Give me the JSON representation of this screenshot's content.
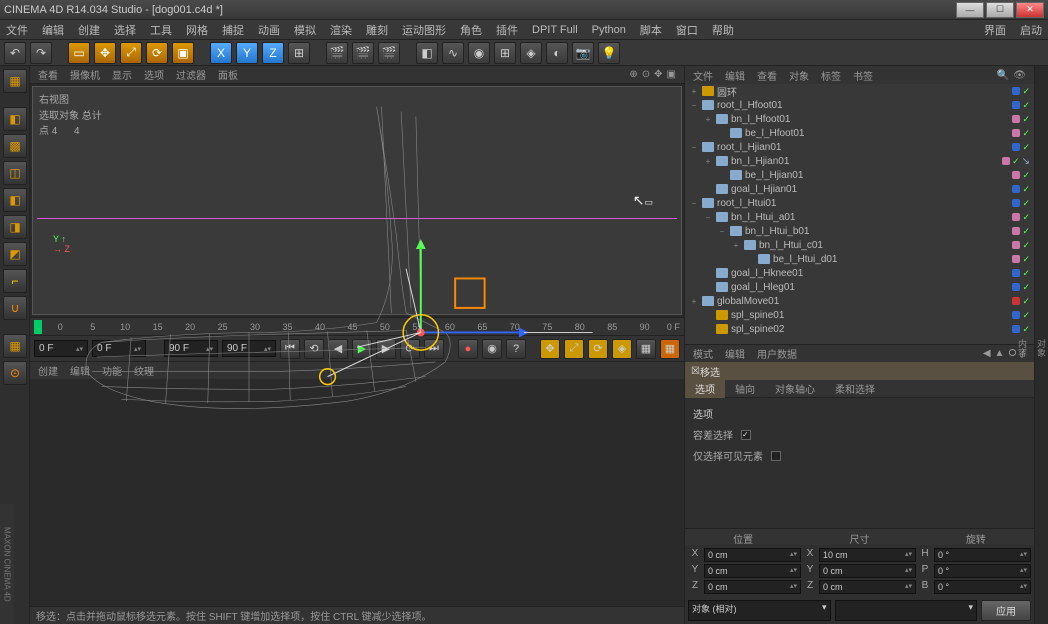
{
  "titlebar": {
    "title": "CINEMA 4D R14.034 Studio - [dog001.c4d *]"
  },
  "menubar": {
    "items": [
      "文件",
      "编辑",
      "创建",
      "选择",
      "工具",
      "网格",
      "捕捉",
      "动画",
      "模拟",
      "渲染",
      "雕刻",
      "运动图形",
      "角色",
      "插件",
      "DPIT Full",
      "Python",
      "脚本",
      "窗口",
      "帮助"
    ],
    "right": [
      "界面",
      "启动"
    ]
  },
  "view_tabs": {
    "items": [
      "查看",
      "摄像机",
      "显示",
      "选项",
      "过滤器",
      "面板"
    ]
  },
  "viewport": {
    "label": "右视图",
    "sel_label": "选取对象 总计",
    "sel_pts": "点 4",
    "sel_total": "4"
  },
  "timeline": {
    "ticks": [
      "0",
      "5",
      "10",
      "15",
      "20",
      "25",
      "30",
      "35",
      "40",
      "45",
      "50",
      "55",
      "60",
      "65",
      "70",
      "75",
      "80",
      "85",
      "90"
    ],
    "end_label": "0 F"
  },
  "playbar": {
    "f0": "0 F",
    "f1": "0 F",
    "f2": "90 F",
    "f3": "90 F"
  },
  "lower_tabs": {
    "items": [
      "创建",
      "编辑",
      "功能",
      "纹理"
    ]
  },
  "statusbar": {
    "text": "移选：点击并拖动鼠标移选元素。按住 SHIFT 键增加选择项，按住 CTRL 键减少选择项。"
  },
  "obj_tabs": {
    "items": [
      "文件",
      "编辑",
      "查看",
      "对象",
      "标签",
      "书签"
    ]
  },
  "tree": [
    {
      "d": 0,
      "exp": "+",
      "name": "圆环",
      "ico": "#c90",
      "dot": "blue",
      "chk": true
    },
    {
      "d": 0,
      "exp": "−",
      "name": "root_l_Hfoot01",
      "ico": "#8ac",
      "dot": "blue",
      "chk": true
    },
    {
      "d": 1,
      "exp": "+",
      "name": "bn_l_Hfoot01",
      "ico": "#8ac",
      "dot": "pink",
      "chk": true
    },
    {
      "d": 2,
      "exp": "",
      "name": "be_l_Hfoot01",
      "ico": "#8ac",
      "dot": "pink",
      "chk": true
    },
    {
      "d": 0,
      "exp": "−",
      "name": "root_l_Hjian01",
      "ico": "#8ac",
      "dot": "blue",
      "chk": true
    },
    {
      "d": 1,
      "exp": "+",
      "name": "bn_l_Hjian01",
      "ico": "#8ac",
      "dot": "pink",
      "chk": true,
      "ext": true
    },
    {
      "d": 2,
      "exp": "",
      "name": "be_l_Hjian01",
      "ico": "#8ac",
      "dot": "pink",
      "chk": true
    },
    {
      "d": 1,
      "exp": "",
      "name": "goal_l_Hjian01",
      "ico": "#8ac",
      "dot": "blue",
      "chk": true
    },
    {
      "d": 0,
      "exp": "−",
      "name": "root_l_Htui01",
      "ico": "#8ac",
      "dot": "blue",
      "chk": true
    },
    {
      "d": 1,
      "exp": "−",
      "name": "bn_l_Htui_a01",
      "ico": "#8ac",
      "dot": "pink",
      "chk": true
    },
    {
      "d": 2,
      "exp": "−",
      "name": "bn_l_Htui_b01",
      "ico": "#8ac",
      "dot": "pink",
      "chk": true
    },
    {
      "d": 3,
      "exp": "+",
      "name": "bn_l_Htui_c01",
      "ico": "#8ac",
      "dot": "pink",
      "chk": true
    },
    {
      "d": 4,
      "exp": "",
      "name": "be_l_Htui_d01",
      "ico": "#8ac",
      "dot": "pink",
      "chk": true
    },
    {
      "d": 1,
      "exp": "",
      "name": "goal_l_Hknee01",
      "ico": "#8ac",
      "dot": "blue",
      "chk": true
    },
    {
      "d": 1,
      "exp": "",
      "name": "goal_l_Hleg01",
      "ico": "#8ac",
      "dot": "blue",
      "chk": true
    },
    {
      "d": 0,
      "exp": "+",
      "name": "globalMove01",
      "ico": "#8ac",
      "dot": "red",
      "chk": true
    },
    {
      "d": 1,
      "exp": "",
      "name": "spl_spine01",
      "ico": "#c90",
      "dot": "blue",
      "chk": true
    },
    {
      "d": 1,
      "exp": "",
      "name": "spl_spine02",
      "ico": "#c90",
      "dot": "blue",
      "chk": true
    }
  ],
  "attr_tabs": {
    "items": [
      "模式",
      "编辑",
      "用户数据"
    ]
  },
  "tool": {
    "header": "移选",
    "tabs": [
      "选项",
      "轴向",
      "对象轴心",
      "柔和选择"
    ],
    "opt_title": "选项",
    "opt1": "容差选择",
    "opt2": "仅选择可见元素"
  },
  "coord": {
    "headers": [
      "位置",
      "尺寸",
      "旋转"
    ],
    "rows": [
      {
        "a": "X",
        "av": "0 cm",
        "b": "X",
        "bv": "10 cm",
        "c": "H",
        "cv": "0 °"
      },
      {
        "a": "Y",
        "av": "0 cm",
        "b": "Y",
        "bv": "0 cm",
        "c": "P",
        "cv": "0 °"
      },
      {
        "a": "Z",
        "av": "0 cm",
        "b": "Z",
        "bv": "0 cm",
        "c": "B",
        "cv": "0 °"
      }
    ],
    "mode1": "对象 (相对)",
    "apply": "应用"
  },
  "brand": "MAXON CINEMA 4D"
}
